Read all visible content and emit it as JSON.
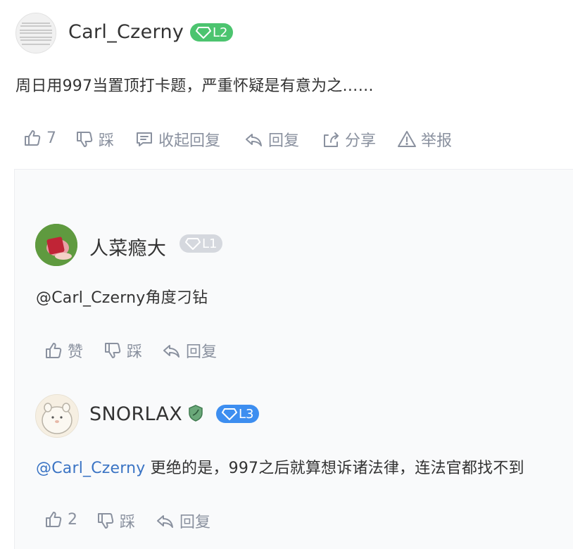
{
  "comment": {
    "author": "Carl_Czerny",
    "level": "L2",
    "level_color": "#4cc46f",
    "text": "周日用997当置顶打卡题，严重怀疑是有意为之……",
    "actions": {
      "like_count": "7",
      "dislike_label": "踩",
      "collapse_label": "收起回复",
      "reply_label": "回复",
      "share_label": "分享",
      "report_label": "举报"
    }
  },
  "replies": [
    {
      "author": "人菜瘾大",
      "level": "L1",
      "level_color": "#d5d8de",
      "text": "@Carl_Czerny角度刁钻",
      "like_label": "赞",
      "dislike_label": "踩",
      "reply_label": "回复"
    },
    {
      "author": "SNORLAX",
      "level": "L3",
      "level_color": "#3d8ef0",
      "mention": "@Carl_Czerny",
      "text": " 更绝的是，997之后就算想诉诸法律，连法官都找不到",
      "like_count": "2",
      "dislike_label": "踩",
      "reply_label": "回复"
    }
  ]
}
